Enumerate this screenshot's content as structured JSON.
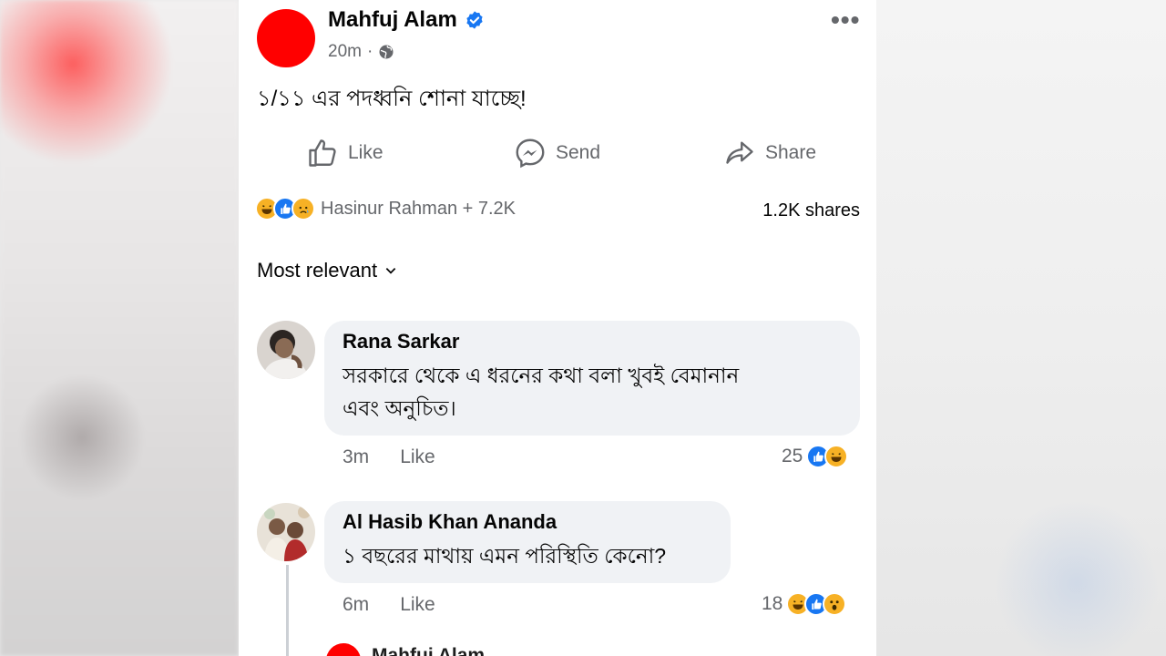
{
  "post": {
    "author": "Mahfuj Alam",
    "time": "20m",
    "meta_separator": "·",
    "text": "১/১১ এর পদধ্বনি শোনা যাচ্ছে!",
    "more_label": "•••"
  },
  "actions": {
    "like": "Like",
    "send": "Send",
    "share": "Share"
  },
  "reactions": {
    "summary": "Hasinur Rahman + 7.2K",
    "shares": "1.2K shares",
    "icons": [
      "haha-icon",
      "like-icon",
      "sad-icon"
    ]
  },
  "sort": {
    "label": "Most relevant"
  },
  "comments": [
    {
      "name": "Rana Sarkar",
      "text_line1": "সরকারে থেকে এ ধরনের কথা বলা খুবই বেমানান",
      "text_line2": "এবং অনুচিত।",
      "time": "3m",
      "like_label": "Like",
      "reaction_count": "25",
      "reaction_icons": [
        "like-icon",
        "haha-icon"
      ]
    },
    {
      "name": "Al Hasib Khan Ananda",
      "text_line1": "১ বছরের মাথায় এমন পরিস্থিতি কেনো?",
      "time": "6m",
      "like_label": "Like",
      "reaction_count": "18",
      "reaction_icons": [
        "haha-icon",
        "like-icon",
        "wow-icon"
      ]
    }
  ],
  "reply_preview": {
    "name": "Mahfuj Alam"
  },
  "colors": {
    "avatar_red": "#ff0000",
    "verified_blue": "#1877f2",
    "secondary_text": "#65676b",
    "bubble_bg": "#f0f2f5"
  }
}
